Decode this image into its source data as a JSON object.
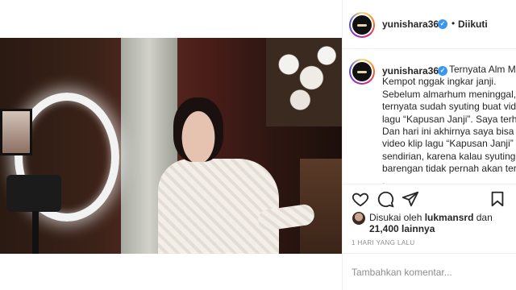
{
  "post": {
    "image_alt": "",
    "author": {
      "username": "yunishara36",
      "verified_icon": "verified-badge-icon",
      "follow_status": "Diikuti",
      "separator": "•"
    },
    "caption": {
      "username": "yunishara36",
      "lines": [
        "Ternyata Alm Ma",
        "Kempot nggak ingkar janji.",
        "Sebelum almarhum meninggal, b",
        "ternyata sudah syuting buat video",
        "lagu “Kapusan Janji”. Saya terha",
        "Dan hari ini akhirnya saya bisa bi",
        "video klip lagu “Kapusan Janji”",
        "sendirian, karena kalau syuting",
        "barengan tidak pernah akan terja",
        "."
      ]
    },
    "actions": {
      "like_icon": "heart-icon",
      "comment_icon": "comment-icon",
      "share_icon": "share-icon",
      "bookmark_icon": "bookmark-icon"
    },
    "likes": {
      "prefix": "Disukai oleh",
      "liker": "lukmansrd",
      "conj": "dan",
      "count_text": "21,400 lainnya"
    },
    "timestamp": "1 HARI YANG LALU",
    "comment_placeholder": "Tambahkan komentar..."
  },
  "colors": {
    "verified": "#3897f0",
    "text": "#262626",
    "muted": "#8e8e8e",
    "border": "#efefef"
  }
}
